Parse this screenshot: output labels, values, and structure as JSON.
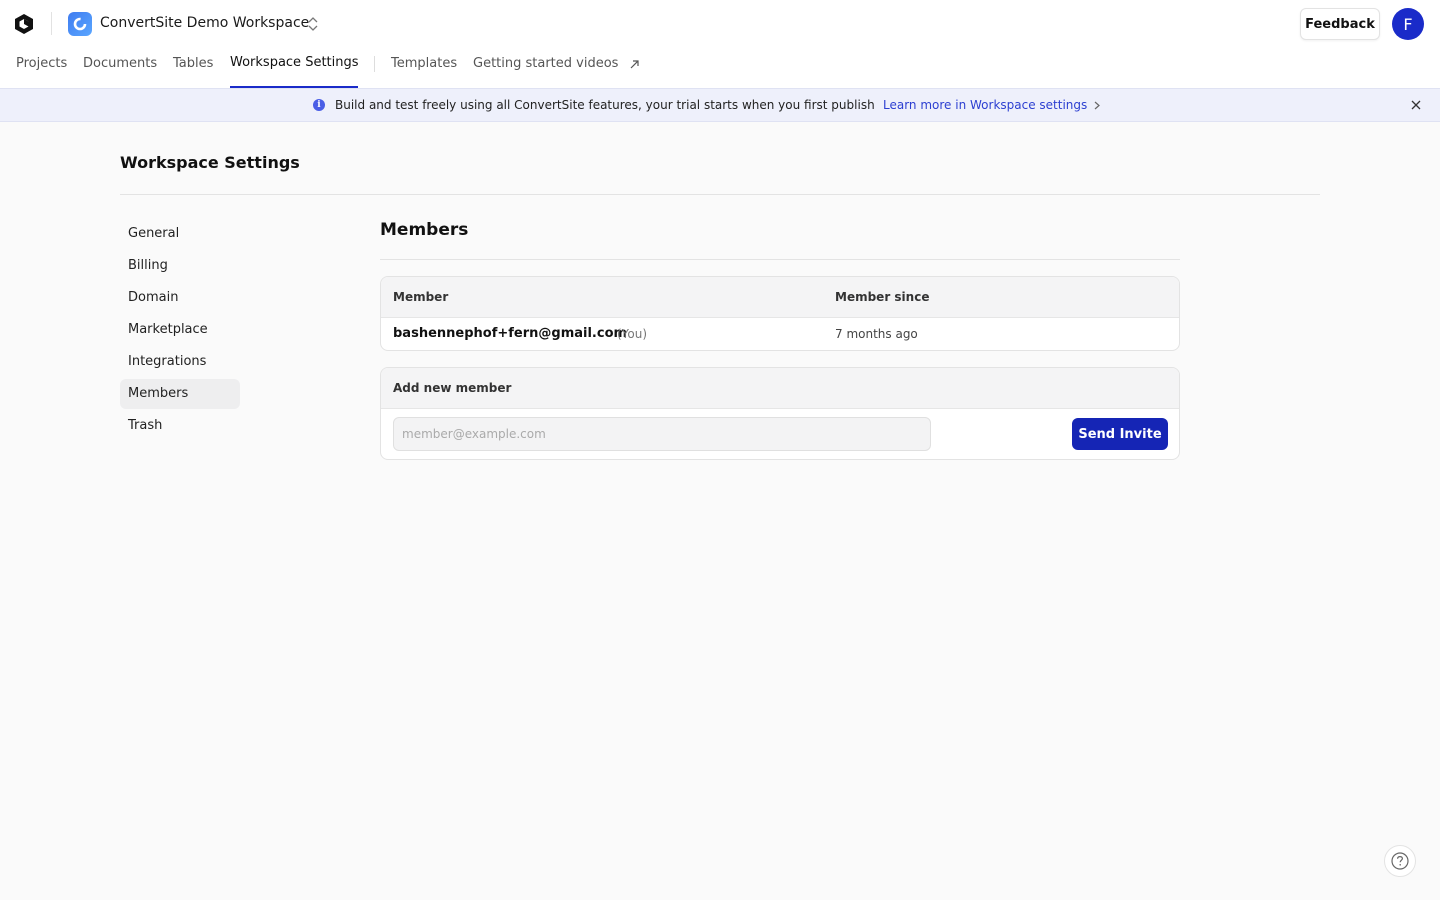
{
  "workspace": {
    "name": "ConvertSite Demo Workspace"
  },
  "header": {
    "feedback_label": "Feedback",
    "avatar_initial": "F"
  },
  "nav": {
    "items": [
      "Projects",
      "Documents",
      "Tables",
      "Workspace Settings",
      "Templates",
      "Getting started videos"
    ],
    "active": "Workspace Settings"
  },
  "banner": {
    "text": "Build and test freely using all ConvertSite features, your trial starts when you first publish",
    "link": "Learn more in Workspace settings"
  },
  "page": {
    "title": "Workspace Settings"
  },
  "sidebar": {
    "items": [
      "General",
      "Billing",
      "Domain",
      "Marketplace",
      "Integrations",
      "Members",
      "Trash"
    ],
    "active": "Members"
  },
  "members": {
    "title": "Members",
    "columns": [
      "Member",
      "Member since"
    ],
    "rows": [
      {
        "email": "bashennephof+fern@gmail.com",
        "tag": "(You)",
        "since": "7 months ago"
      }
    ]
  },
  "invite": {
    "title": "Add new member",
    "placeholder": "member@example.com",
    "button": "Send Invite"
  },
  "colors": {
    "accent": "#1525b5",
    "banner_bg": "#eef0fb",
    "link": "#2c3fd1"
  },
  "icons": [
    "app-logo-icon",
    "workspace-icon",
    "switch-chevrons-icon",
    "external-link-icon",
    "info-icon",
    "chevron-right-icon",
    "close-icon",
    "help-icon"
  ]
}
